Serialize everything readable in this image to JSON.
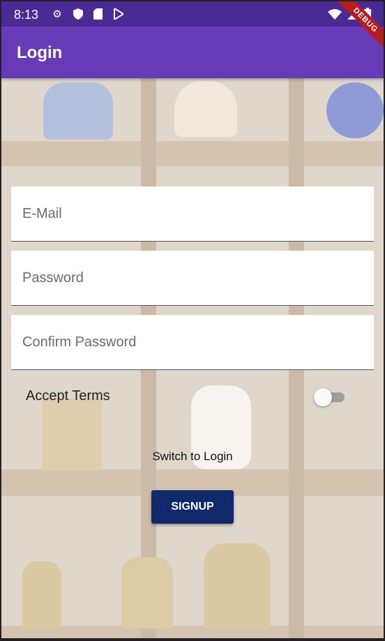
{
  "status_bar": {
    "time": "8:13",
    "icons_left": [
      "gear-icon",
      "shield-icon",
      "sd-card-icon",
      "play-store-icon"
    ],
    "icons_right": [
      "wifi-icon",
      "signal-icon",
      "battery-icon"
    ]
  },
  "app_bar": {
    "title": "Login"
  },
  "debug_banner": "DEBUG",
  "form": {
    "email_placeholder": "E-Mail",
    "password_placeholder": "Password",
    "confirm_placeholder": "Confirm Password",
    "accept_terms_label": "Accept Terms",
    "accept_terms_value": false,
    "switch_label": "Switch to Login",
    "signup_label": "SIGNUP"
  },
  "colors": {
    "primary": "#673ab7",
    "status_bar": "#4a2a94",
    "button": "#11296b"
  }
}
